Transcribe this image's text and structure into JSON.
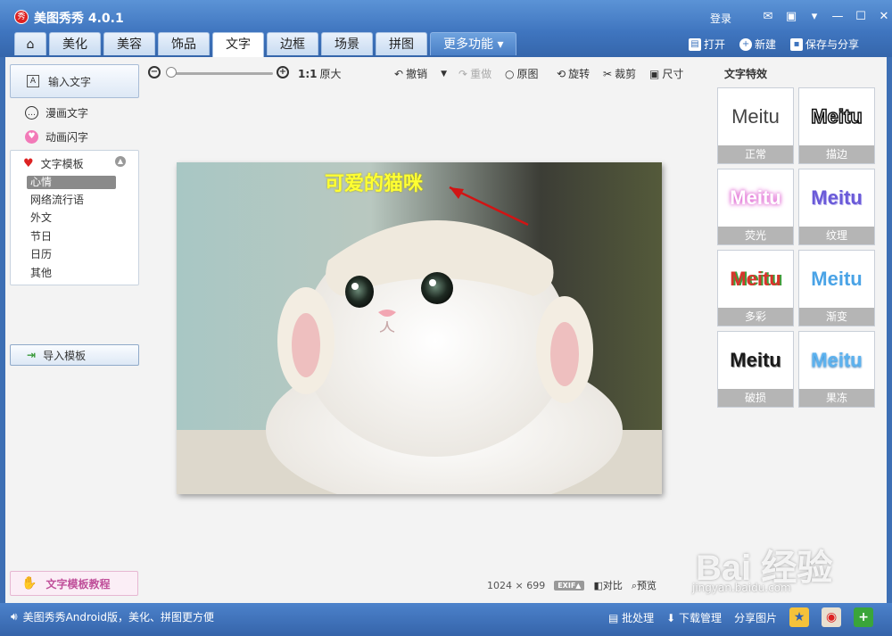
{
  "app": {
    "title": "美图秀秀 4.0.1",
    "login": "登录",
    "logo_text": "秀"
  },
  "tabs": [
    {
      "label": "美化"
    },
    {
      "label": "美容"
    },
    {
      "label": "饰品"
    },
    {
      "label": "文字"
    },
    {
      "label": "边框"
    },
    {
      "label": "场景"
    },
    {
      "label": "拼图"
    },
    {
      "label": "更多功能 ▾"
    }
  ],
  "actions": {
    "open": "打开",
    "new": "新建",
    "save": "保存与分享"
  },
  "left": {
    "input_text": "输入文字",
    "comic_text": "漫画文字",
    "anim_text": "动画闪字",
    "template_header": "文字模板",
    "template_items": [
      "心情",
      "网络流行语",
      "外文",
      "节日",
      "日历",
      "其他"
    ],
    "import_template": "导入模板",
    "tutorial": "文字模板教程"
  },
  "toolbar": {
    "ratio": "1:1",
    "original_size": "原大",
    "undo": "撤销",
    "redo": "重做",
    "original": "原图",
    "rotate": "旋转",
    "crop": "裁剪",
    "size": "尺寸"
  },
  "canvas": {
    "overlay_text": "可爱的猫咪"
  },
  "image_info": {
    "width": "1024",
    "sep": "×",
    "height": "699",
    "exif": "EXIF▲",
    "compare": "对比",
    "preview": "预览"
  },
  "effects": {
    "title": "文字特效",
    "sample": "Meitu",
    "items": [
      {
        "label": "正常"
      },
      {
        "label": "描边"
      },
      {
        "label": "荧光"
      },
      {
        "label": "纹理"
      },
      {
        "label": "多彩"
      },
      {
        "label": "渐变"
      },
      {
        "label": "破损"
      },
      {
        "label": "果冻"
      }
    ]
  },
  "status": {
    "message": "美图秀秀Android版，美化、拼图更方便",
    "batch": "批处理",
    "download": "下载管理",
    "share": "分享图片"
  },
  "watermark": {
    "brand": "Bai 经验",
    "url": "jingyan.baidu.com"
  },
  "colors": {
    "accent": "#3f75bf",
    "overlay_text": "#ffff33",
    "selected_item": "#8a8a8a"
  }
}
